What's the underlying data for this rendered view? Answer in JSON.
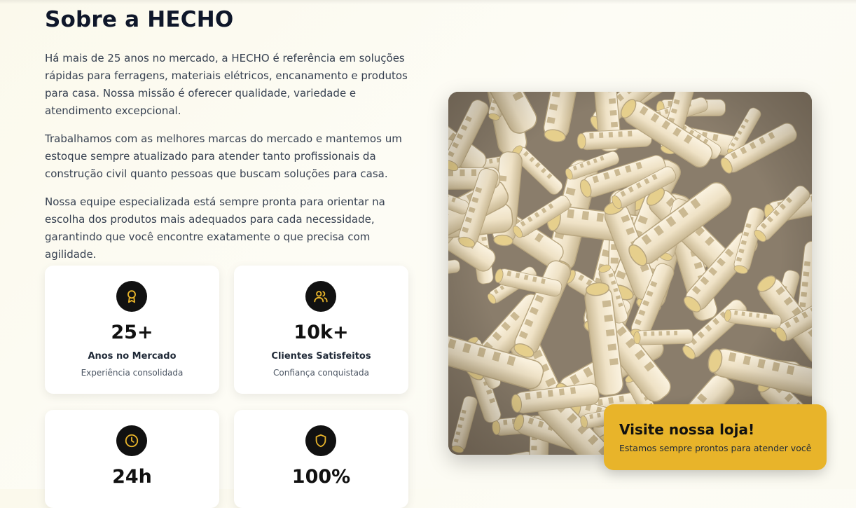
{
  "section": {
    "title": "Sobre a HECHO",
    "paragraphs": [
      "Há mais de 25 anos no mercado, a HECHO é referência em soluções rápidas para ferragens, materiais elétricos, encanamento e produtos para casa. Nossa missão é oferecer qualidade, variedade e atendimento excepcional.",
      "Trabalhamos com as melhores marcas do mercado e mantemos um estoque sempre atualizado para atender tanto profissionais da construção civil quanto pessoas que buscam soluções para casa.",
      "Nossa equipe especializada está sempre pronta para orientar na escolha dos produtos mais adequados para cada necessidade, garantindo que você encontre exatamente o que precisa com agilidade."
    ]
  },
  "stats": [
    {
      "icon": "award-icon",
      "value": "25+",
      "label": "Anos no Mercado",
      "sub": "Experiência consolidada"
    },
    {
      "icon": "users-icon",
      "value": "10k+",
      "label": "Clientes Satisfeitos",
      "sub": "Confiança conquistada"
    },
    {
      "icon": "clock-icon",
      "value": "24h",
      "label": "",
      "sub": ""
    },
    {
      "icon": "shield-icon",
      "value": "100%",
      "label": "",
      "sub": ""
    }
  ],
  "image": {
    "subject": "wall-plugs-photo"
  },
  "cta": {
    "title": "Visite nossa loja!",
    "subtitle": "Estamos sempre prontos para atender você"
  },
  "colors": {
    "accent": "#e8b42a",
    "icon_bg": "#111111",
    "icon_stroke": "#e8b42a",
    "heading": "#0f172a"
  }
}
